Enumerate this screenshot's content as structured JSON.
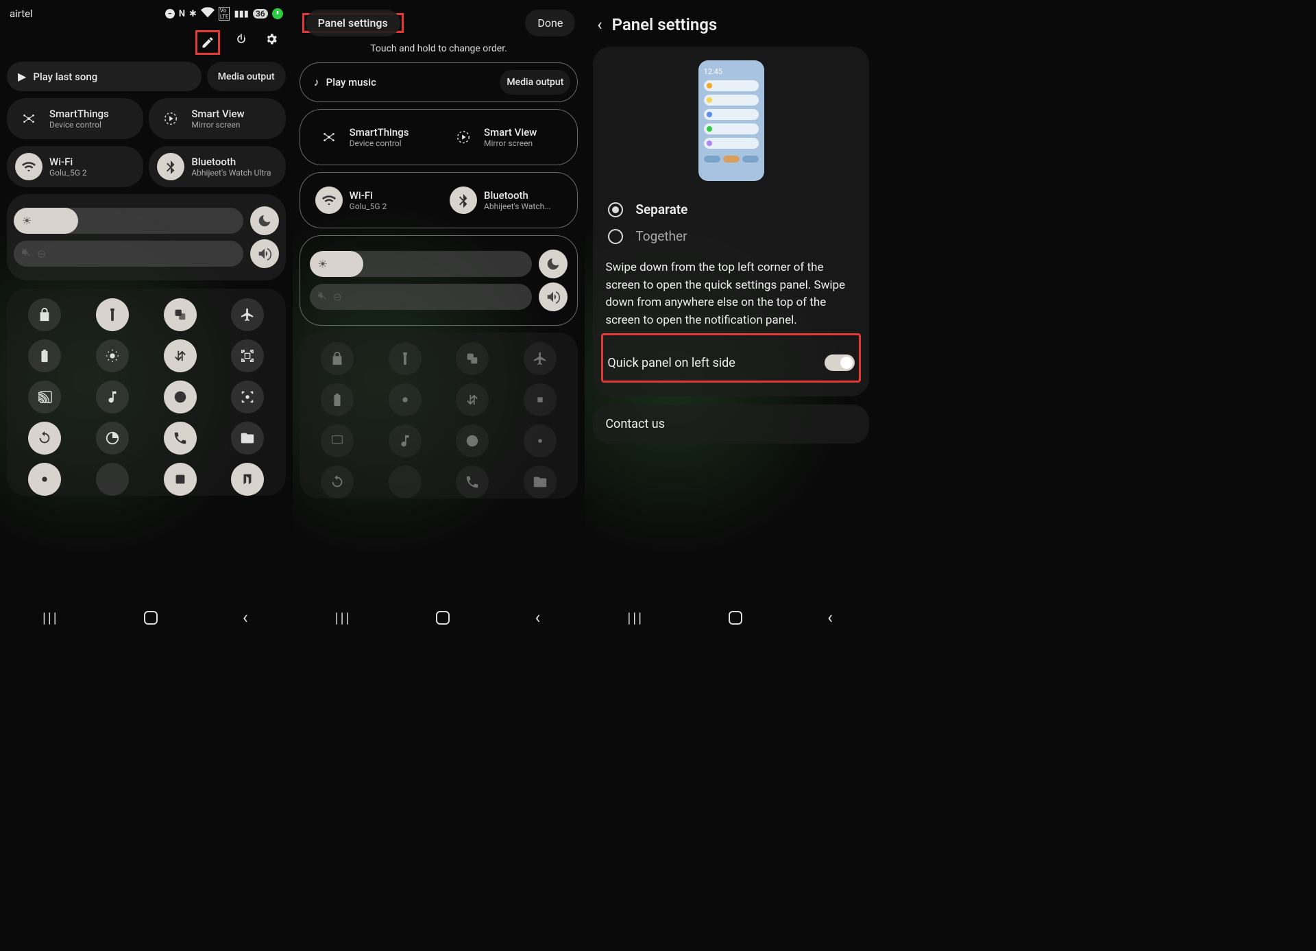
{
  "status": {
    "carrier": "airtel",
    "battery": "36"
  },
  "s1": {
    "play_last": "Play last song",
    "media_output": "Media output",
    "smartthings": "SmartThings",
    "smartthings_sub": "Device control",
    "smartview": "Smart View",
    "smartview_sub": "Mirror screen",
    "wifi": "Wi-Fi",
    "wifi_sub": "Golu_5G 2",
    "bt": "Bluetooth",
    "bt_sub": "Abhijeet's Watch Ultra"
  },
  "s2": {
    "panel_settings": "Panel settings",
    "done": "Done",
    "hint": "Touch and hold to change order.",
    "play_music": "Play music",
    "media_output": "Media output",
    "smartthings": "SmartThings",
    "smartthings_sub": "Device control",
    "smartview": "Smart View",
    "smartview_sub": "Mirror screen",
    "wifi": "Wi-Fi",
    "wifi_sub": "Golu_5G 2",
    "bt": "Bluetooth",
    "bt_sub": "Abhijeet's Watch..."
  },
  "s3": {
    "title": "Panel settings",
    "mock_time": "12:45",
    "opt1": "Separate",
    "opt2": "Together",
    "desc": "Swipe down from the top left corner of the screen to open the quick settings panel. Swipe down from anywhere else on the top of the screen to open the notification panel.",
    "toggle": "Quick panel on left side",
    "contact": "Contact us"
  }
}
